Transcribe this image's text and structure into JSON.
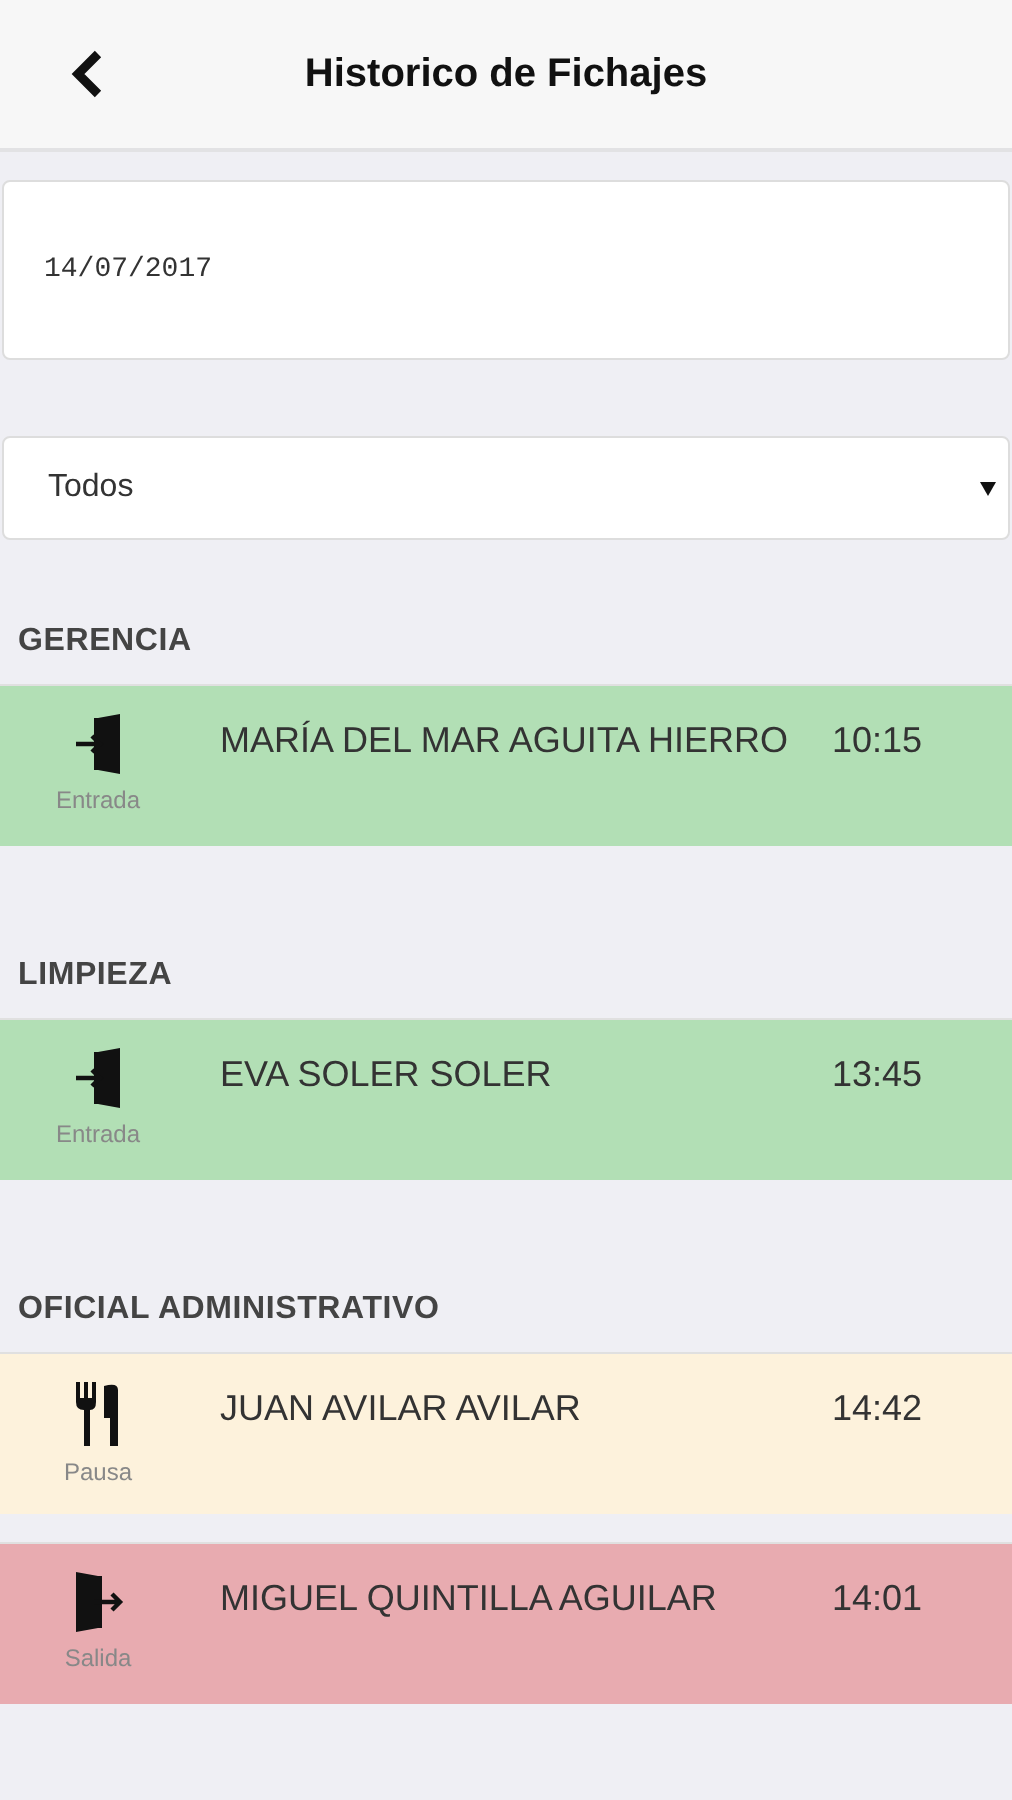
{
  "header": {
    "title": "Historico de Fichajes"
  },
  "date_field": {
    "value": "14/07/2017"
  },
  "filter": {
    "value": "Todos"
  },
  "groups": [
    {
      "title": "GERENCIA",
      "entries": [
        {
          "kind": "entrada",
          "label": "Entrada",
          "name": "MARÍA DEL MAR AGUITA HIERRO",
          "time": "10:15"
        }
      ]
    },
    {
      "title": "LIMPIEZA",
      "entries": [
        {
          "kind": "entrada",
          "label": "Entrada",
          "name": "EVA SOLER SOLER",
          "time": "13:45"
        }
      ]
    },
    {
      "title": "OFICIAL ADMINISTRATIVO",
      "entries": [
        {
          "kind": "pausa",
          "label": "Pausa",
          "name": "JUAN AVILAR AVILAR",
          "time": "14:42"
        },
        {
          "kind": "salida",
          "label": "Salida",
          "name": "MIGUEL QUINTILLA AGUILAR",
          "time": "14:01"
        }
      ]
    }
  ]
}
